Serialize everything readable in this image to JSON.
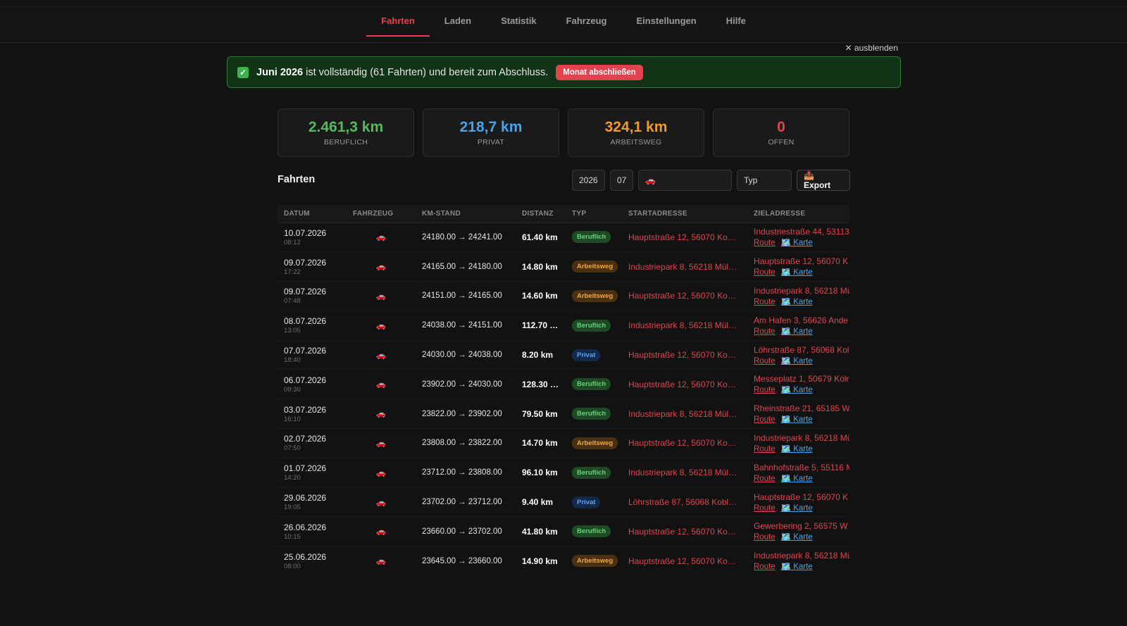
{
  "nav": {
    "tabs": [
      {
        "label": "Fahrten",
        "active": true
      },
      {
        "label": "Laden",
        "active": false
      },
      {
        "label": "Statistik",
        "active": false
      },
      {
        "label": "Fahrzeug",
        "active": false
      },
      {
        "label": "Einstellungen",
        "active": false
      },
      {
        "label": "Hilfe",
        "active": false
      }
    ]
  },
  "hide_link": "✕ ausblenden",
  "banner": {
    "check": "✓",
    "month": "Juni 2026",
    "message": " ist vollständig (61 Fahrten) und bereit zum Abschluss.",
    "button": "Monat abschließen"
  },
  "cards": [
    {
      "value": "2.461,3 km",
      "label": "BERUFLICH",
      "color": "#57b95e"
    },
    {
      "value": "218,7 km",
      "label": "PRIVAT",
      "color": "#4aa3e6"
    },
    {
      "value": "324,1 km",
      "label": "ARBEITSWEG",
      "color": "#f09a2a"
    },
    {
      "value": "0",
      "label": "OFFEN",
      "color": "#e2434f"
    }
  ],
  "section_title": "Fahrten",
  "filters": {
    "year": "2026",
    "month": "07",
    "vehicle_icon": "🚗",
    "type_placeholder": "Typ",
    "export_label": "📤 Export"
  },
  "table": {
    "headers": [
      "DATUM",
      "FAHRZEUG",
      "KM-STAND",
      "DISTANZ",
      "TYP",
      "STARTADRESSE",
      "ZIELADRESSE"
    ],
    "route_label": "Route",
    "map_label": "🗺️ Karte",
    "vehicle_icon": "🚗",
    "rows": [
      {
        "date": "10.07.2026",
        "time": "08:12",
        "km": "24180.00 → 24241.00",
        "dist": "61.40 km",
        "type": "Beruflich",
        "start": "Hauptstraße 12, 56070 Ko…",
        "ziel": "Industriestraße 44, 53113"
      },
      {
        "date": "09.07.2026",
        "time": "17:22",
        "km": "24165.00 → 24180.00",
        "dist": "14.80 km",
        "type": "Arbeitsweg",
        "start": "Industriepark 8, 56218 Mül…",
        "ziel": "Hauptstraße 12, 56070 K"
      },
      {
        "date": "09.07.2026",
        "time": "07:48",
        "km": "24151.00 → 24165.00",
        "dist": "14.60 km",
        "type": "Arbeitsweg",
        "start": "Hauptstraße 12, 56070 Ko…",
        "ziel": "Industriepark 8, 56218 Mü"
      },
      {
        "date": "08.07.2026",
        "time": "13:05",
        "km": "24038.00 → 24151.00",
        "dist": "112.70 …",
        "type": "Beruflich",
        "start": "Industriepark 8, 56218 Mül…",
        "ziel": "Am Hafen 3, 56626 Ande"
      },
      {
        "date": "07.07.2026",
        "time": "18:40",
        "km": "24030.00 → 24038.00",
        "dist": "8.20 km",
        "type": "Privat",
        "start": "Hauptstraße 12, 56070 Ko…",
        "ziel": "Löhrstraße 87, 56068 Kol"
      },
      {
        "date": "06.07.2026",
        "time": "09:30",
        "km": "23902.00 → 24030.00",
        "dist": "128.30 …",
        "type": "Beruflich",
        "start": "Hauptstraße 12, 56070 Ko…",
        "ziel": "Messeplatz 1, 50679 Köln"
      },
      {
        "date": "03.07.2026",
        "time": "16:10",
        "km": "23822.00 → 23902.00",
        "dist": "79.50 km",
        "type": "Beruflich",
        "start": "Industriepark 8, 56218 Mül…",
        "ziel": "Rheinstraße 21, 65185 W"
      },
      {
        "date": "02.07.2026",
        "time": "07:50",
        "km": "23808.00 → 23822.00",
        "dist": "14.70 km",
        "type": "Arbeitsweg",
        "start": "Hauptstraße 12, 56070 Ko…",
        "ziel": "Industriepark 8, 56218 Mü"
      },
      {
        "date": "01.07.2026",
        "time": "14:20",
        "km": "23712.00 → 23808.00",
        "dist": "96.10 km",
        "type": "Beruflich",
        "start": "Industriepark 8, 56218 Mül…",
        "ziel": "Bahnhofstraße 5, 55116 M"
      },
      {
        "date": "29.06.2026",
        "time": "19:05",
        "km": "23702.00 → 23712.00",
        "dist": "9.40 km",
        "type": "Privat",
        "start": "Löhrstraße 87, 56068 Kobl…",
        "ziel": "Hauptstraße 12, 56070 K"
      },
      {
        "date": "26.06.2026",
        "time": "10:15",
        "km": "23660.00 → 23702.00",
        "dist": "41.80 km",
        "type": "Beruflich",
        "start": "Hauptstraße 12, 56070 Ko…",
        "ziel": "Gewerbering 2, 56575 W"
      },
      {
        "date": "25.06.2026",
        "time": "08:00",
        "km": "23645.00 → 23660.00",
        "dist": "14.90 km",
        "type": "Arbeitsweg",
        "start": "Hauptstraße 12, 56070 Ko…",
        "ziel": "Industriepark 8, 56218 Mü"
      }
    ]
  }
}
